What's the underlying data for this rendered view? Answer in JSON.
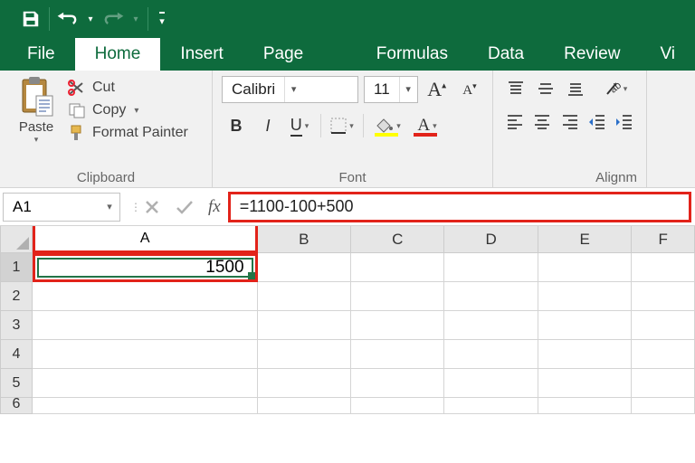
{
  "qat": {
    "save": "save-icon",
    "undo": "undo-icon",
    "redo": "redo-icon"
  },
  "tabs": {
    "file": "File",
    "home": "Home",
    "insert": "Insert",
    "pagelayout": "Page Layout",
    "formulas": "Formulas",
    "data": "Data",
    "review": "Review",
    "view": "Vi"
  },
  "clipboard": {
    "paste": "Paste",
    "cut": "Cut",
    "copy": "Copy",
    "copy_dd": "▾",
    "format_painter": "Format Painter",
    "group_label": "Clipboard"
  },
  "font": {
    "name": "Calibri",
    "size": "11",
    "group_label": "Font",
    "bold": "B",
    "italic": "I",
    "underline": "U"
  },
  "alignment": {
    "group_label": "Alignm"
  },
  "formula_bar": {
    "cell_ref": "A1",
    "formula": "=1100-100+500",
    "fx": "fx"
  },
  "grid": {
    "columns": [
      "A",
      "B",
      "C",
      "D",
      "E",
      "F"
    ],
    "rows": [
      "1",
      "2",
      "3",
      "4",
      "5",
      "6"
    ],
    "active_value": "1500"
  }
}
